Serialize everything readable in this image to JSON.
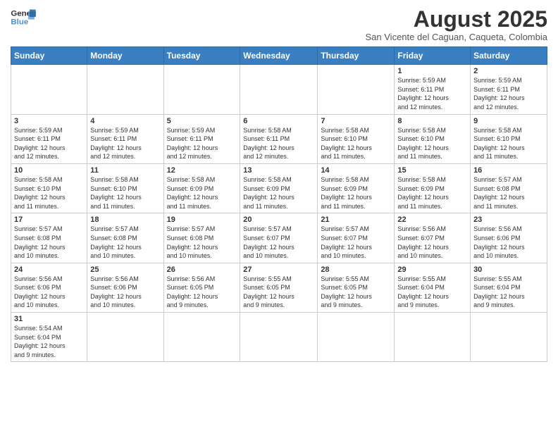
{
  "logo": {
    "line1": "General",
    "line2": "Blue"
  },
  "header": {
    "title": "August 2025",
    "subtitle": "San Vicente del Caguan, Caqueta, Colombia"
  },
  "weekdays": [
    "Sunday",
    "Monday",
    "Tuesday",
    "Wednesday",
    "Thursday",
    "Friday",
    "Saturday"
  ],
  "weeks": [
    [
      {
        "day": "",
        "info": ""
      },
      {
        "day": "",
        "info": ""
      },
      {
        "day": "",
        "info": ""
      },
      {
        "day": "",
        "info": ""
      },
      {
        "day": "",
        "info": ""
      },
      {
        "day": "1",
        "info": "Sunrise: 5:59 AM\nSunset: 6:11 PM\nDaylight: 12 hours\nand 12 minutes."
      },
      {
        "day": "2",
        "info": "Sunrise: 5:59 AM\nSunset: 6:11 PM\nDaylight: 12 hours\nand 12 minutes."
      }
    ],
    [
      {
        "day": "3",
        "info": "Sunrise: 5:59 AM\nSunset: 6:11 PM\nDaylight: 12 hours\nand 12 minutes."
      },
      {
        "day": "4",
        "info": "Sunrise: 5:59 AM\nSunset: 6:11 PM\nDaylight: 12 hours\nand 12 minutes."
      },
      {
        "day": "5",
        "info": "Sunrise: 5:59 AM\nSunset: 6:11 PM\nDaylight: 12 hours\nand 12 minutes."
      },
      {
        "day": "6",
        "info": "Sunrise: 5:58 AM\nSunset: 6:11 PM\nDaylight: 12 hours\nand 12 minutes."
      },
      {
        "day": "7",
        "info": "Sunrise: 5:58 AM\nSunset: 6:10 PM\nDaylight: 12 hours\nand 11 minutes."
      },
      {
        "day": "8",
        "info": "Sunrise: 5:58 AM\nSunset: 6:10 PM\nDaylight: 12 hours\nand 11 minutes."
      },
      {
        "day": "9",
        "info": "Sunrise: 5:58 AM\nSunset: 6:10 PM\nDaylight: 12 hours\nand 11 minutes."
      }
    ],
    [
      {
        "day": "10",
        "info": "Sunrise: 5:58 AM\nSunset: 6:10 PM\nDaylight: 12 hours\nand 11 minutes."
      },
      {
        "day": "11",
        "info": "Sunrise: 5:58 AM\nSunset: 6:10 PM\nDaylight: 12 hours\nand 11 minutes."
      },
      {
        "day": "12",
        "info": "Sunrise: 5:58 AM\nSunset: 6:09 PM\nDaylight: 12 hours\nand 11 minutes."
      },
      {
        "day": "13",
        "info": "Sunrise: 5:58 AM\nSunset: 6:09 PM\nDaylight: 12 hours\nand 11 minutes."
      },
      {
        "day": "14",
        "info": "Sunrise: 5:58 AM\nSunset: 6:09 PM\nDaylight: 12 hours\nand 11 minutes."
      },
      {
        "day": "15",
        "info": "Sunrise: 5:58 AM\nSunset: 6:09 PM\nDaylight: 12 hours\nand 11 minutes."
      },
      {
        "day": "16",
        "info": "Sunrise: 5:57 AM\nSunset: 6:08 PM\nDaylight: 12 hours\nand 11 minutes."
      }
    ],
    [
      {
        "day": "17",
        "info": "Sunrise: 5:57 AM\nSunset: 6:08 PM\nDaylight: 12 hours\nand 10 minutes."
      },
      {
        "day": "18",
        "info": "Sunrise: 5:57 AM\nSunset: 6:08 PM\nDaylight: 12 hours\nand 10 minutes."
      },
      {
        "day": "19",
        "info": "Sunrise: 5:57 AM\nSunset: 6:08 PM\nDaylight: 12 hours\nand 10 minutes."
      },
      {
        "day": "20",
        "info": "Sunrise: 5:57 AM\nSunset: 6:07 PM\nDaylight: 12 hours\nand 10 minutes."
      },
      {
        "day": "21",
        "info": "Sunrise: 5:57 AM\nSunset: 6:07 PM\nDaylight: 12 hours\nand 10 minutes."
      },
      {
        "day": "22",
        "info": "Sunrise: 5:56 AM\nSunset: 6:07 PM\nDaylight: 12 hours\nand 10 minutes."
      },
      {
        "day": "23",
        "info": "Sunrise: 5:56 AM\nSunset: 6:06 PM\nDaylight: 12 hours\nand 10 minutes."
      }
    ],
    [
      {
        "day": "24",
        "info": "Sunrise: 5:56 AM\nSunset: 6:06 PM\nDaylight: 12 hours\nand 10 minutes."
      },
      {
        "day": "25",
        "info": "Sunrise: 5:56 AM\nSunset: 6:06 PM\nDaylight: 12 hours\nand 10 minutes."
      },
      {
        "day": "26",
        "info": "Sunrise: 5:56 AM\nSunset: 6:05 PM\nDaylight: 12 hours\nand 9 minutes."
      },
      {
        "day": "27",
        "info": "Sunrise: 5:55 AM\nSunset: 6:05 PM\nDaylight: 12 hours\nand 9 minutes."
      },
      {
        "day": "28",
        "info": "Sunrise: 5:55 AM\nSunset: 6:05 PM\nDaylight: 12 hours\nand 9 minutes."
      },
      {
        "day": "29",
        "info": "Sunrise: 5:55 AM\nSunset: 6:04 PM\nDaylight: 12 hours\nand 9 minutes."
      },
      {
        "day": "30",
        "info": "Sunrise: 5:55 AM\nSunset: 6:04 PM\nDaylight: 12 hours\nand 9 minutes."
      }
    ],
    [
      {
        "day": "31",
        "info": "Sunrise: 5:54 AM\nSunset: 6:04 PM\nDaylight: 12 hours\nand 9 minutes."
      },
      {
        "day": "",
        "info": ""
      },
      {
        "day": "",
        "info": ""
      },
      {
        "day": "",
        "info": ""
      },
      {
        "day": "",
        "info": ""
      },
      {
        "day": "",
        "info": ""
      },
      {
        "day": "",
        "info": ""
      }
    ]
  ]
}
